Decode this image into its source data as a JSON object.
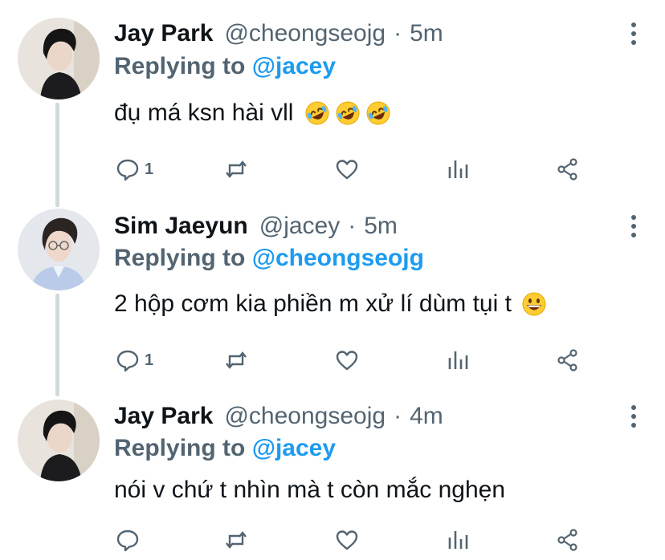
{
  "tweets": [
    {
      "name": "Jay Park",
      "handle": "@cheongseojg",
      "separator": "·",
      "time": "5m",
      "reply_prefix": "Replying to",
      "reply_to": "@jacey",
      "text": "đụ má ksn hài vll",
      "emoji": [
        "rolling-on-floor-laughing",
        "rolling-on-floor-laughing",
        "rolling-on-floor-laughing"
      ],
      "reply_count": "1"
    },
    {
      "name": "Sim Jaeyun",
      "handle": "@jacey",
      "separator": "·",
      "time": "5m",
      "reply_prefix": "Replying to",
      "reply_to": "@cheongseojg",
      "text": "2 hộp cơm kia phiền m xử lí dùm tụi t",
      "emoji": [
        "grinning-face"
      ],
      "reply_count": "1"
    },
    {
      "name": "Jay Park",
      "handle": "@cheongseojg",
      "separator": "·",
      "time": "4m",
      "reply_prefix": "Replying to",
      "reply_to": "@jacey",
      "text": "nói v chứ t nhìn mà t còn mắc nghẹn",
      "emoji": [],
      "reply_count": ""
    }
  ],
  "icons": {
    "reply": "speech-bubble-icon",
    "retweet": "retweet-arrows-icon",
    "like": "heart-icon",
    "analytics": "bar-chart-icon",
    "share": "share-nodes-icon",
    "more": "vertical-dots-icon"
  },
  "colors": {
    "name": "#0f1419",
    "secondary": "#536471",
    "link": "#1d9bf0",
    "thread_line": "#cfd9de"
  }
}
